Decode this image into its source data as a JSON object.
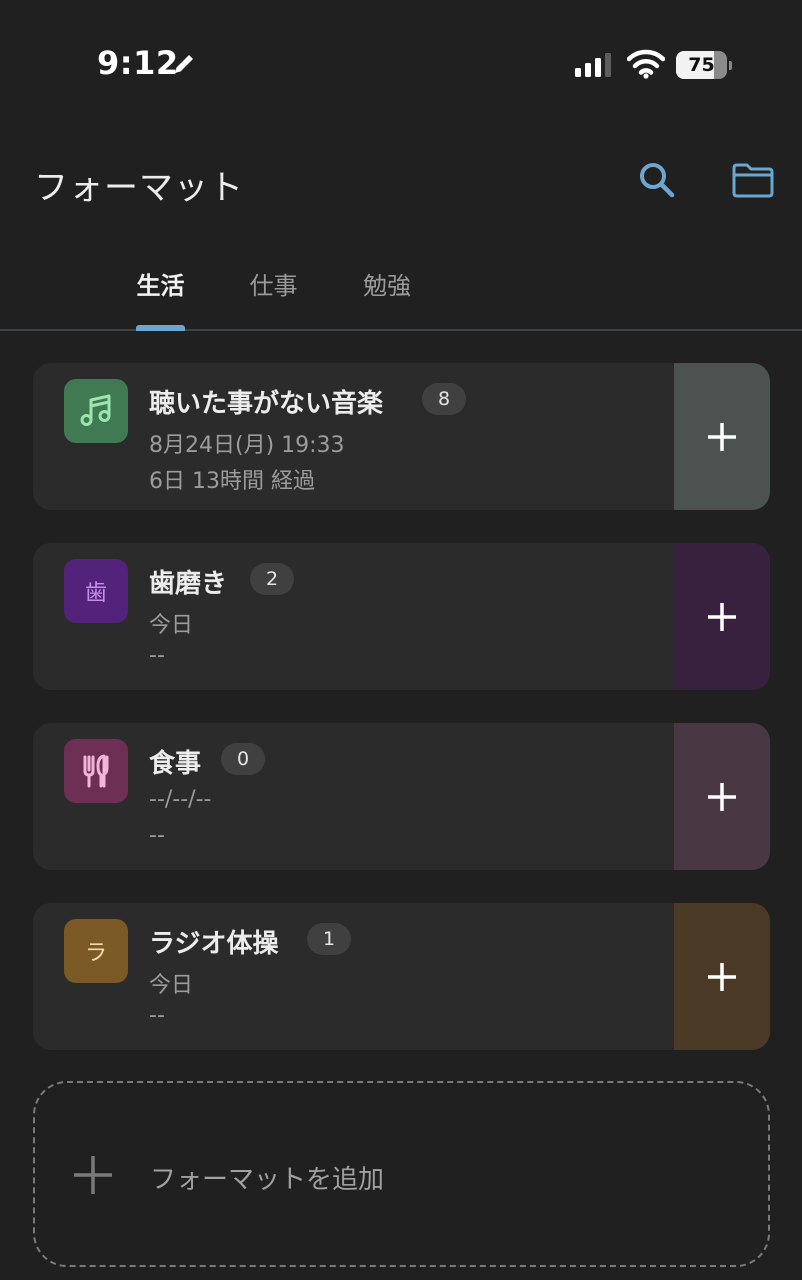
{
  "status_bar": {
    "time": "9:12",
    "battery_level": "75"
  },
  "header": {
    "title": "フォーマット",
    "search_icon": "search-icon",
    "folder_icon": "folder-icon"
  },
  "tabs": [
    {
      "label": "生活",
      "active": true
    },
    {
      "label": "仕事",
      "active": false
    },
    {
      "label": "勉強",
      "active": false
    }
  ],
  "cards": [
    {
      "icon": "music-note-icon",
      "icon_bg": "#3f7a52",
      "icon_fg": "#9de5ae",
      "title": "聴いた事がない音楽",
      "count": "8",
      "date": "8月24日(月) 19:33",
      "elapsed": "6日 13時間  経過",
      "accent": "#4b524f"
    },
    {
      "icon_text": "歯",
      "icon_bg": "#53237b",
      "icon_fg": "#c78cf2",
      "title": "歯磨き",
      "count": "2",
      "date": "今日",
      "elapsed": "--",
      "accent": "#37213f"
    },
    {
      "icon": "fork-knife-icon",
      "icon_bg": "#6e2f55",
      "icon_fg": "#f0b7d8",
      "title": "食事",
      "count": "0",
      "date": "--/--/--",
      "elapsed": "--",
      "accent": "#4a3744"
    },
    {
      "icon_text": "ラ",
      "icon_bg": "#7b5a26",
      "icon_fg": "#f4dca8",
      "title": "ラジオ体操",
      "count": "1",
      "date": "今日",
      "elapsed": "--",
      "accent": "#4a3a25"
    }
  ],
  "add_format": {
    "label": "フォーマットを追加"
  },
  "colors": {
    "background": "#202020",
    "card": "#2b2b2b",
    "accent_blue": "#6ba7d0"
  }
}
